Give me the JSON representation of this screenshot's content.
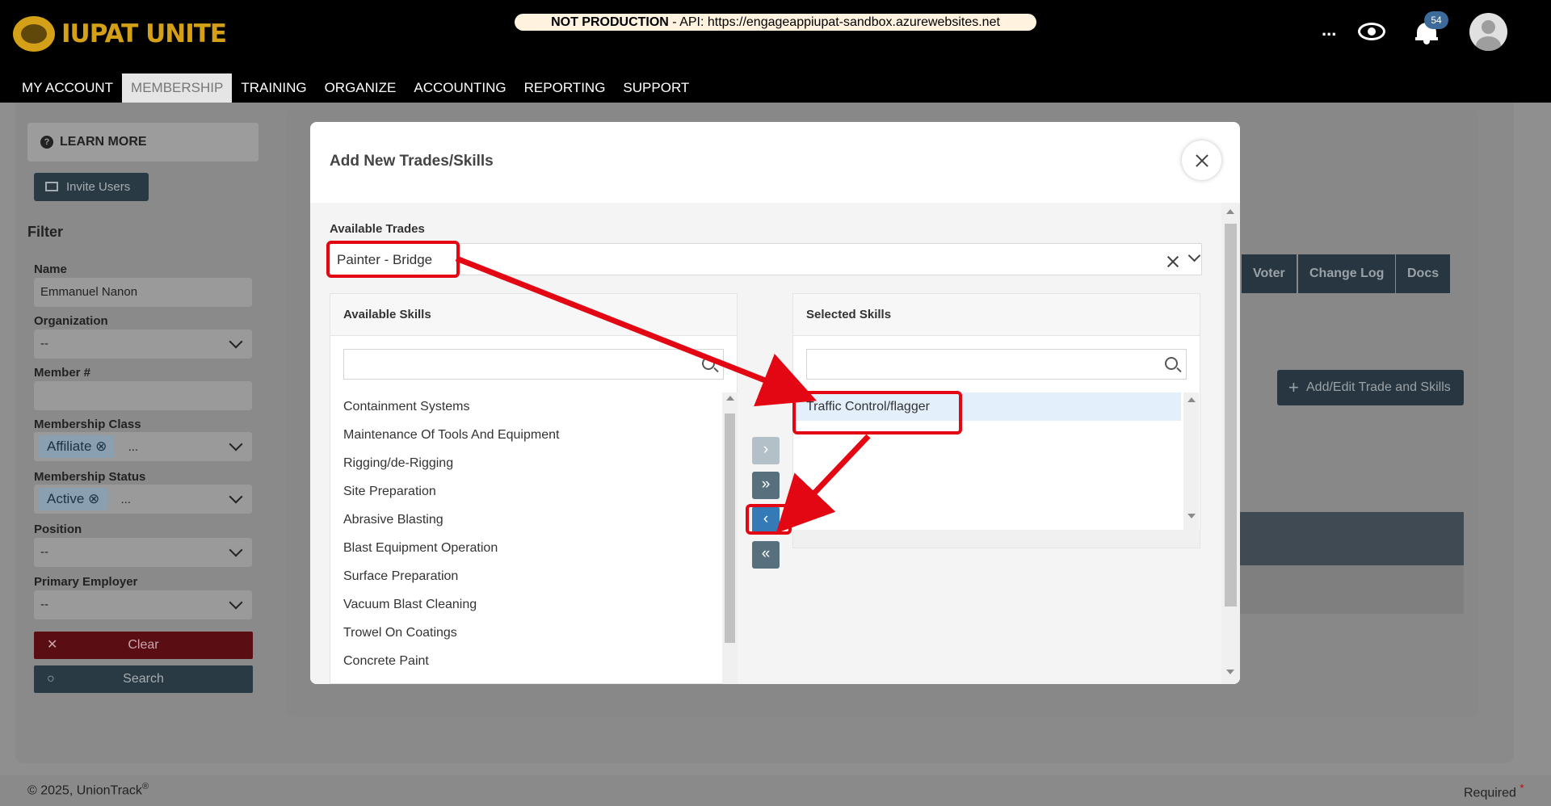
{
  "header": {
    "app_name": "IUPAT UNITE",
    "logo_small": "IUPAT",
    "env_label": "NOT PRODUCTION",
    "env_api": " - API: https://engageappiupat-sandbox.azurewebsites.net",
    "ellipsis": "...",
    "notification_count": "54"
  },
  "nav": {
    "items": [
      "MY ACCOUNT",
      "MEMBERSHIP",
      "TRAINING",
      "ORGANIZE",
      "ACCOUNTING",
      "REPORTING",
      "SUPPORT"
    ],
    "active": "MEMBERSHIP"
  },
  "sidebar": {
    "learn_more": "LEARN MORE",
    "invite_users": "Invite Users",
    "filter_title": "Filter",
    "name_label": "Name",
    "name_value": "Emmanuel Nanon",
    "organization_label": "Organization",
    "organization_value": "--",
    "member_label": "Member #",
    "member_value": "",
    "class_label": "Membership Class",
    "class_chip": "Affiliate",
    "class_more": "...",
    "status_label": "Membership Status",
    "status_chip": "Active",
    "status_more": "...",
    "position_label": "Position",
    "position_value": "--",
    "employer_label": "Primary Employer",
    "employer_value": "--",
    "clear_label": "Clear",
    "search_label": "Search"
  },
  "background": {
    "tabs": [
      "Voter",
      "Change Log",
      "Docs"
    ],
    "add_edit": "Add/Edit Trade and Skills"
  },
  "modal": {
    "title": "Add New Trades/Skills",
    "available_trades_label": "Available Trades",
    "selected_trade": "Painter - Bridge",
    "available_skills_title": "Available Skills",
    "available_skills_search": "",
    "available_skills": [
      "Containment Systems",
      "Maintenance Of Tools And Equipment",
      "Rigging/de-Rigging",
      "Site Preparation",
      "Abrasive Blasting",
      "Blast Equipment Operation",
      "Surface Preparation",
      "Vacuum Blast Cleaning",
      "Trowel On Coatings",
      "Concrete Paint"
    ],
    "selected_skills_title": "Selected Skills",
    "selected_skills_search": "",
    "selected_skills": [
      "Traffic Control/flagger"
    ],
    "move_buttons": {
      "move_right": "›",
      "move_all_right": "»",
      "move_left": "‹",
      "move_all_left": "«"
    }
  },
  "footer": {
    "copyright": "© 2025, UnionTrack",
    "trademark": "®",
    "required": "Required",
    "required_mark": "*"
  },
  "colors": {
    "annotation": "#e30613",
    "logo_gold": "#d4a017",
    "accent_blue": "#337ab7",
    "button_slate": "#58707e"
  }
}
